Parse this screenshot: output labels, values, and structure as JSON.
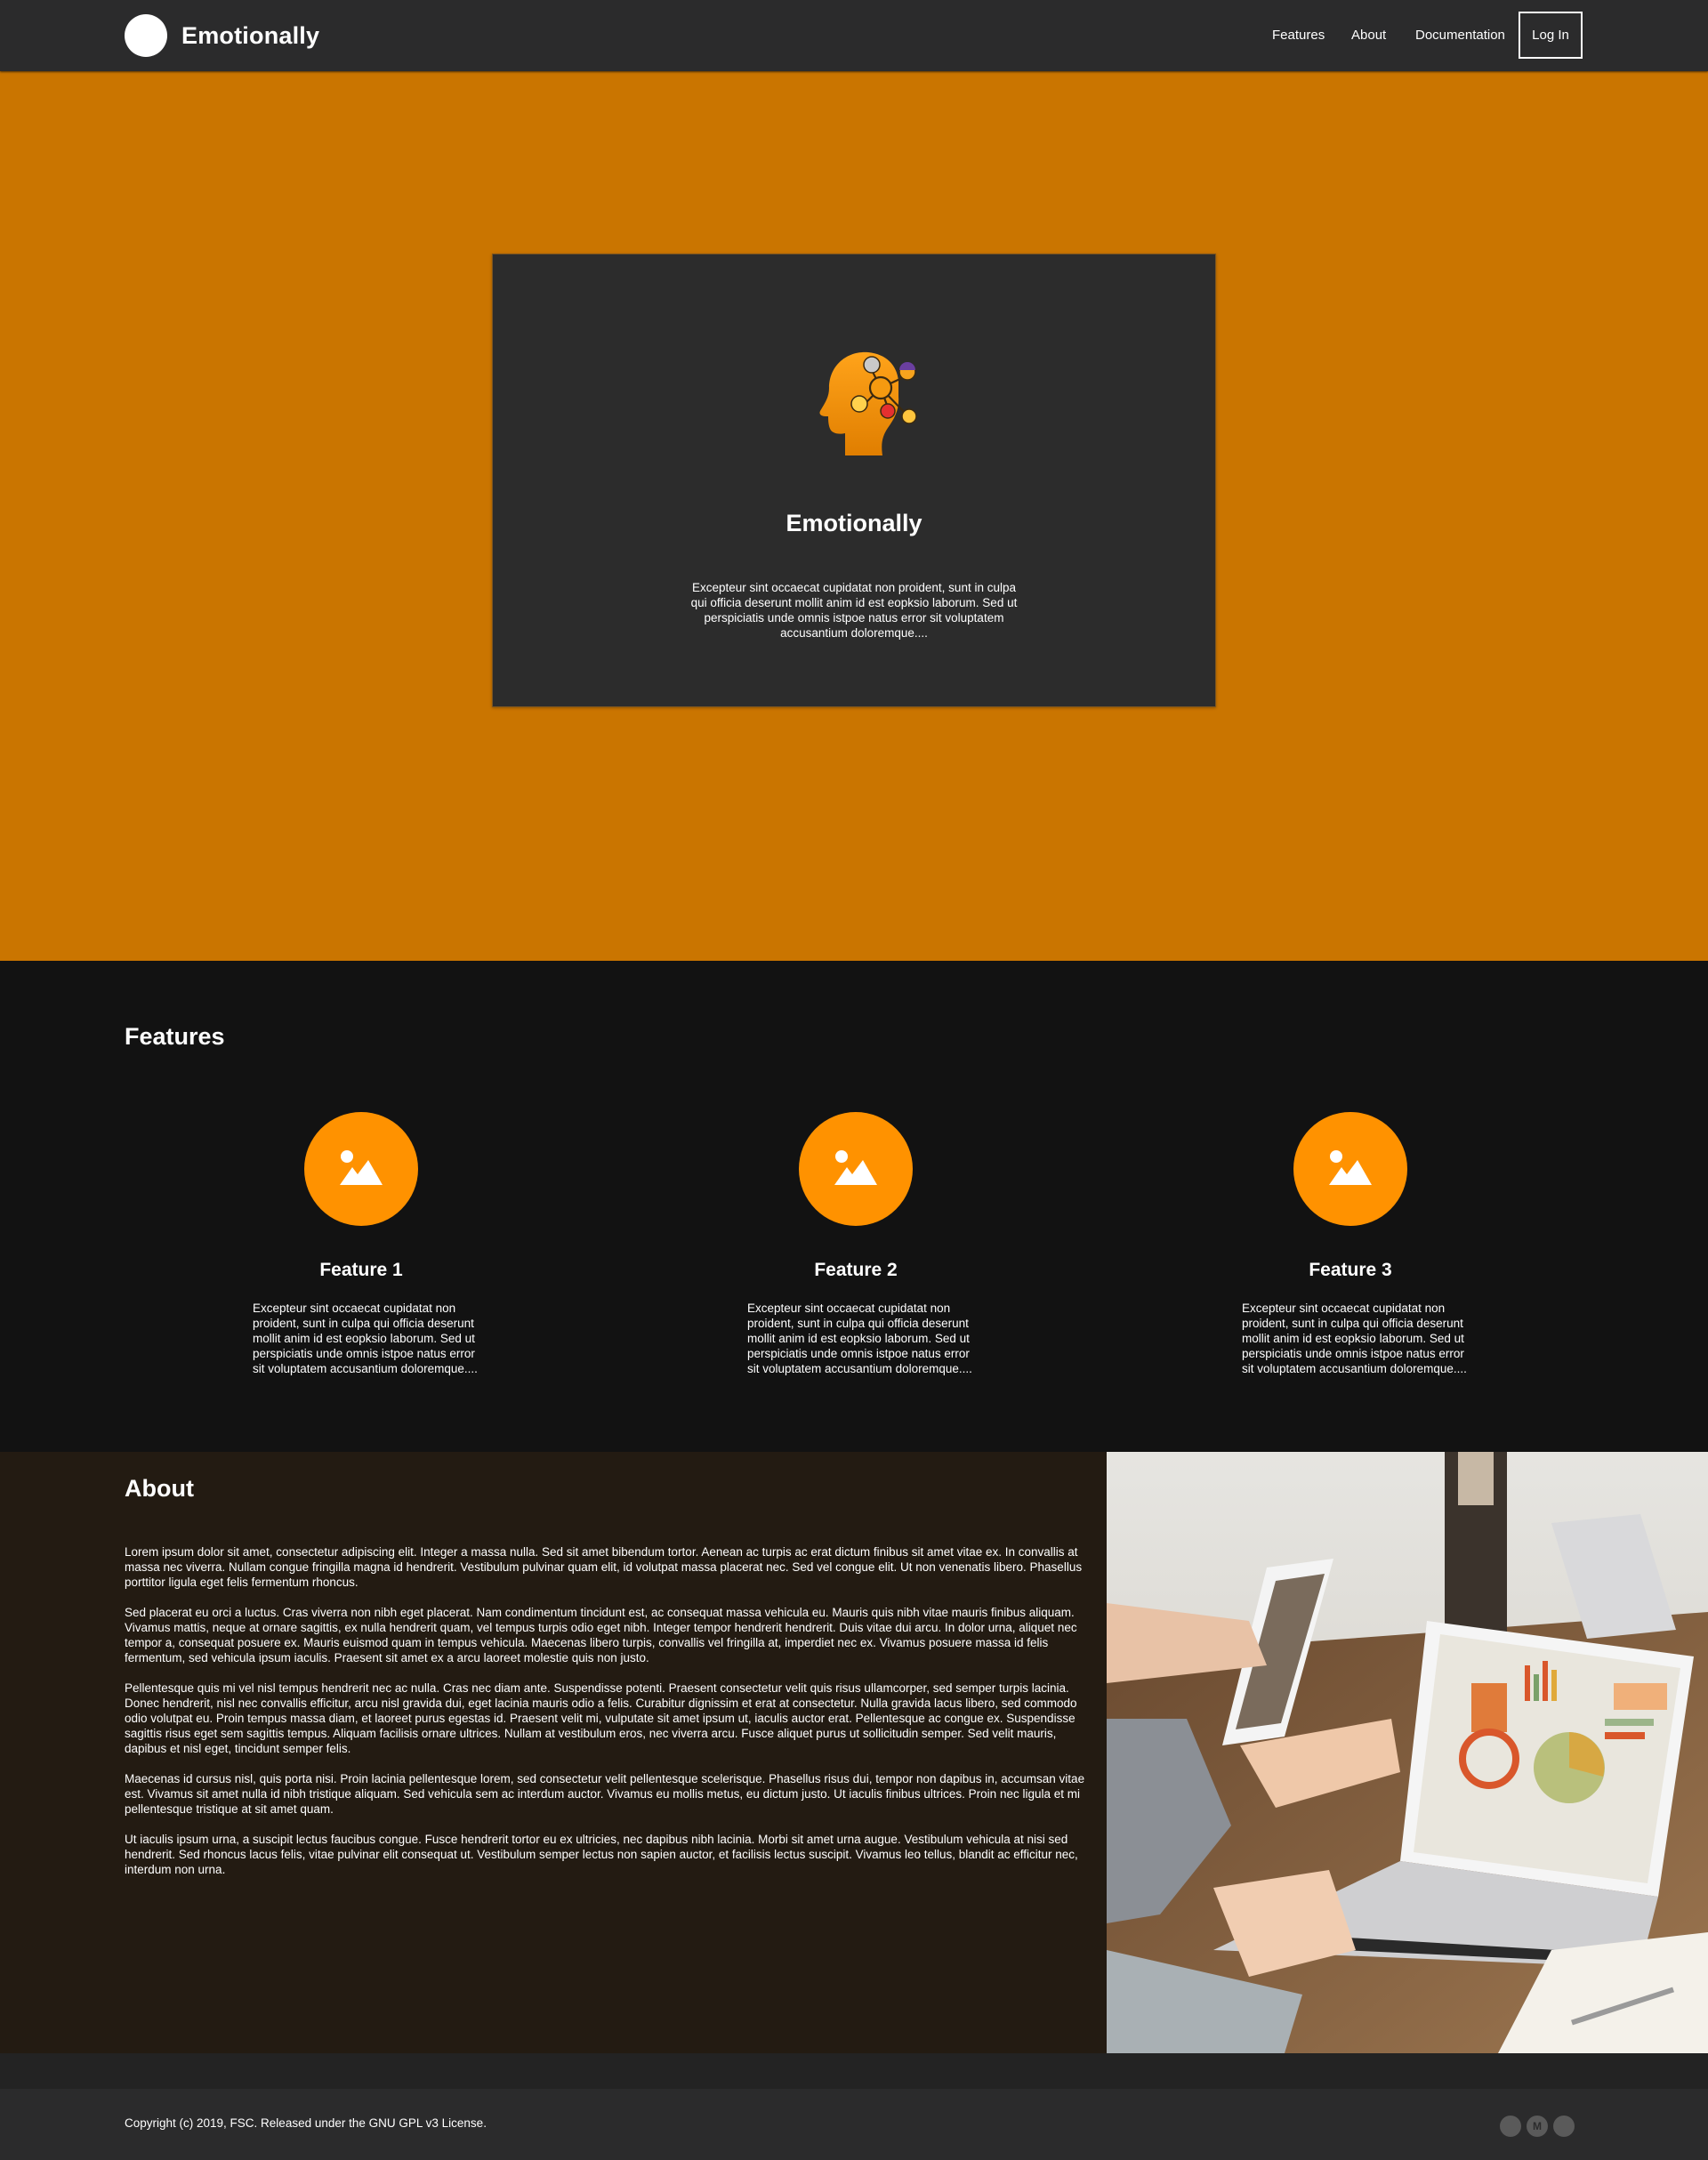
{
  "navbar": {
    "brand_name": "Emotionally",
    "links": [
      "Features",
      "About",
      "Documentation"
    ],
    "login_label": "Log In"
  },
  "hero": {
    "title": "Emotionally",
    "text": "Excepteur sint occaecat cupidatat non proident, sunt in culpa qui officia deserunt mollit anim id est eopksio laborum. Sed ut perspiciatis unde omnis istpoe natus error sit voluptatem accusantium doloremque....",
    "icon": "emotion-head-icon"
  },
  "features": {
    "title": "Features",
    "items": [
      {
        "title": "Feature 1",
        "text": "Excepteur sint occaecat cupidatat non proident, sunt in culpa qui officia deserunt mollit anim id est eopksio laborum. Sed ut perspiciatis unde omnis istpoe natus error sit voluptatem accusantium doloremque....",
        "icon": "image-placeholder-icon"
      },
      {
        "title": "Feature 2",
        "text": "Excepteur sint occaecat cupidatat non proident, sunt in culpa qui officia deserunt mollit anim id est eopksio laborum. Sed ut perspiciatis unde omnis istpoe natus error sit voluptatem accusantium doloremque....",
        "icon": "image-placeholder-icon"
      },
      {
        "title": "Feature 3",
        "text": "Excepteur sint occaecat cupidatat non proident, sunt in culpa qui officia deserunt mollit anim id est eopksio laborum. Sed ut perspiciatis unde omnis istpoe natus error sit voluptatem accusantium doloremque....",
        "icon": "image-placeholder-icon"
      }
    ]
  },
  "about": {
    "title": "About",
    "paragraphs": [
      "Lorem ipsum dolor sit amet, consectetur adipiscing elit. Integer a massa nulla. Sed sit amet bibendum tortor. Aenean ac turpis ac erat dictum finibus sit amet vitae ex. In convallis at massa nec viverra. Nullam congue fringilla magna id hendrerit. Vestibulum pulvinar quam elit, id volutpat massa placerat nec. Sed vel congue elit. Ut non venenatis libero. Phasellus porttitor ligula eget felis fermentum rhoncus.",
      "Sed placerat eu orci a luctus. Cras viverra non nibh eget placerat. Nam condimentum tincidunt est, ac consequat massa vehicula eu. Mauris quis nibh vitae mauris finibus aliquam. Vivamus mattis, neque at ornare sagittis, ex nulla hendrerit quam, vel tempus turpis odio eget nibh. Integer tempor hendrerit hendrerit. Duis vitae dui arcu. In dolor urna, aliquet nec tempor a, consequat posuere ex. Mauris euismod quam in tempus vehicula. Maecenas libero turpis, convallis vel fringilla at, imperdiet nec ex. Vivamus posuere massa id felis fermentum, sed vehicula ipsum iaculis. Praesent sit amet ex a arcu laoreet molestie quis non justo.",
      "Pellentesque quis mi vel nisl tempus hendrerit nec ac nulla. Cras nec diam ante. Suspendisse potenti. Praesent consectetur velit quis risus ullamcorper, sed semper turpis lacinia. Donec hendrerit, nisl nec convallis efficitur, arcu nisl gravida dui, eget lacinia mauris odio a felis. Curabitur dignissim et erat at consectetur. Nulla gravida lacus libero, sed commodo odio volutpat eu. Proin tempus massa diam, et laoreet purus egestas id. Praesent velit mi, vulputate sit amet ipsum ut, iaculis auctor erat. Pellentesque ac congue ex. Suspendisse sagittis risus eget sem sagittis tempus. Aliquam facilisis ornare ultrices. Nullam at vestibulum eros, nec viverra arcu. Fusce aliquet purus ut sollicitudin semper. Sed velit mauris, dapibus et nisl eget, tincidunt semper felis.",
      "Maecenas id cursus nisl, quis porta nisi. Proin lacinia pellentesque lorem, sed consectetur velit pellentesque scelerisque. Phasellus risus dui, tempor non dapibus in, accumsan vitae est. Vivamus sit amet nulla id nibh tristique aliquam. Sed vehicula sem ac interdum auctor. Vivamus eu mollis metus, eu dictum justo. Ut iaculis finibus ultrices. Proin nec ligula et mi pellentesque tristique at sit amet quam.",
      "Ut iaculis ipsum urna, a suscipit lectus faucibus congue. Fusce hendrerit tortor eu ex ultricies, nec dapibus nibh lacinia. Morbi sit amet urna augue. Vestibulum vehicula at nisi sed hendrerit. Sed rhoncus lacus felis, vitae pulvinar elit consequat ut. Vestibulum semper lectus non sapien auctor, et facilisis lectus suscipit. Vivamus leo tellus, blandit ac efficitur nec, interdum non urna."
    ],
    "image": "laptop-analytics-photo"
  },
  "footer": {
    "copyright": "Copyright (c) 2019, FSC. Released under the GNU GPL v3 License.",
    "social": [
      {
        "icon": "social-icon",
        "label": ""
      },
      {
        "icon": "medium-icon",
        "label": "M"
      },
      {
        "icon": "social-icon",
        "label": ""
      }
    ]
  },
  "colors": {
    "hero_bg": "#ca7500",
    "accent": "#ff9200",
    "navbar_bg": "#2b2b2c",
    "features_bg": "#121212",
    "about_bg": "#231b12"
  }
}
